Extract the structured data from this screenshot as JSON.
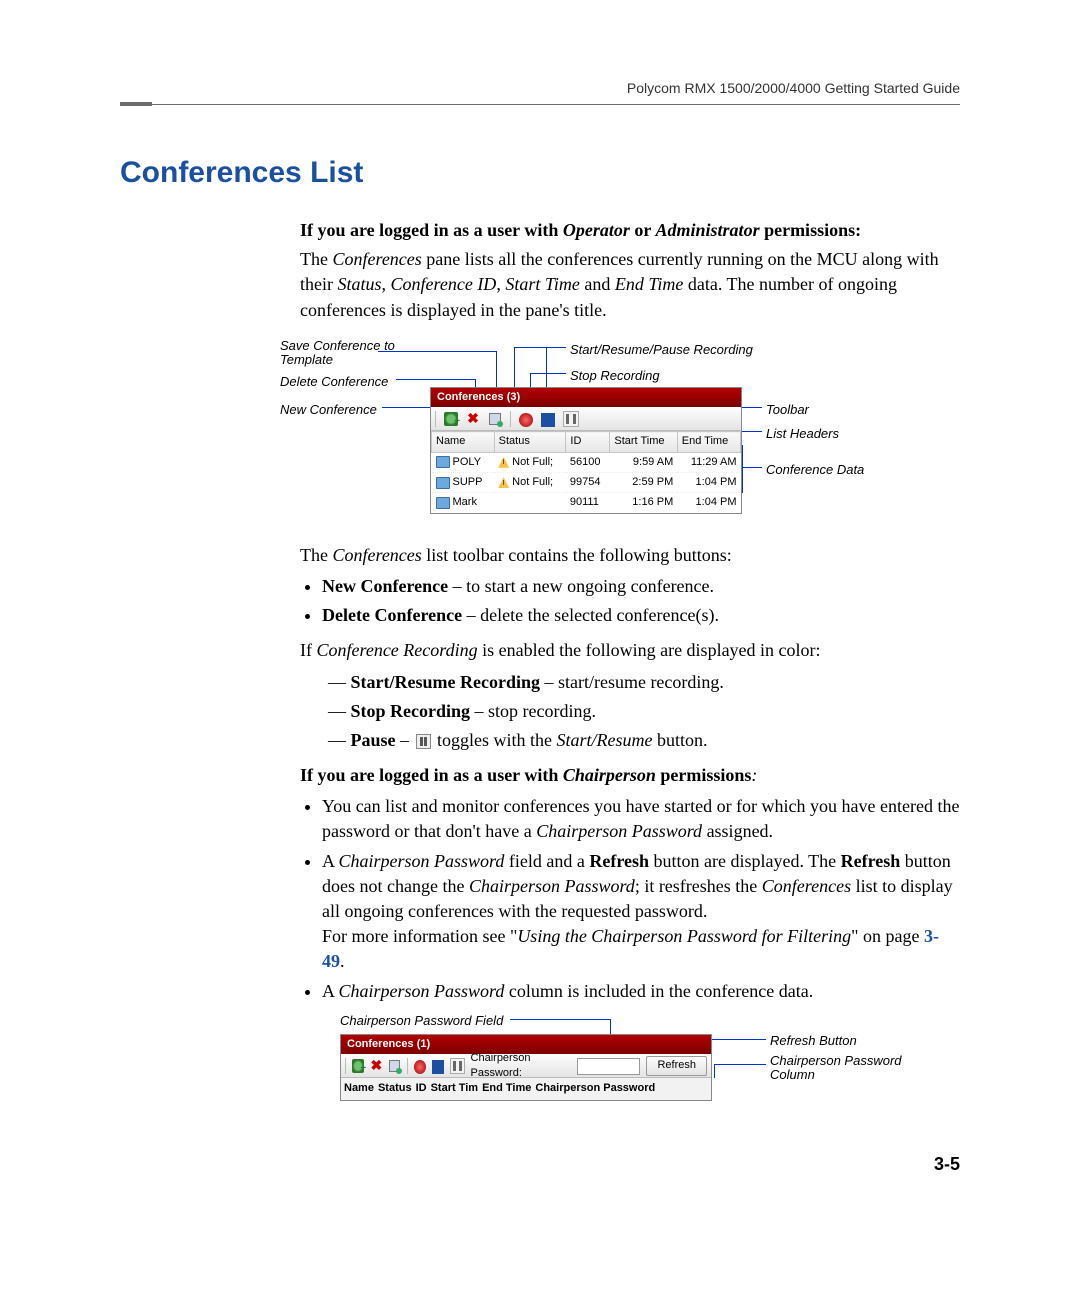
{
  "running_header": "Polycom RMX 1500/2000/4000 Getting Started Guide",
  "section_title": "Conferences List",
  "intro_bold_prefix": "If you are logged in as a user with ",
  "intro_bold_suffix": " permissions:",
  "intro_roles": "Operator",
  "intro_roles_or": " or ",
  "intro_roles2": "Administrator",
  "para1_a": "The ",
  "para1_b": "Conferences",
  "para1_c": " pane lists all the conferences currently running on the MCU along with their ",
  "para1_d": "Status",
  "para1_e": ", ",
  "para1_f": "Conference ID",
  "para1_g": ", ",
  "para1_h": "Start Time",
  "para1_i": " and ",
  "para1_j": "End Time",
  "para1_k": " data. The number of ongoing conferences is displayed in the pane's title.",
  "fig1": {
    "callouts": {
      "save": "Save Conference\nto Template",
      "delete": "Delete Conference",
      "new": "New Conference",
      "start": "Start/Resume/Pause Recording",
      "stop": "Stop Recording",
      "toolbar": "Toolbar",
      "headers": "List Headers",
      "data": "Conference Data"
    },
    "pane_title": "Conferences (3)",
    "columns": [
      "Name",
      "Status",
      "ID",
      "Start Time",
      "End Time"
    ],
    "rows": [
      {
        "name": "POLY",
        "status": "Not Full;",
        "id": "56100",
        "start": "9:59 AM",
        "end": "11:29 AM"
      },
      {
        "name": "SUPP",
        "status": "Not Full;",
        "id": "99754",
        "start": "2:59 PM",
        "end": "1:04 PM"
      },
      {
        "name": "Mark",
        "status": "",
        "id": "90111",
        "start": "1:16 PM",
        "end": "1:04 PM"
      }
    ]
  },
  "para2_a": "The ",
  "para2_b": "Conferences",
  "para2_c": " list toolbar contains the following buttons:",
  "bullet_new_b": "New Conference",
  "bullet_new_t": " – to start a new ongoing conference.",
  "bullet_del_b": "Delete Conference",
  "bullet_del_t": " – delete the selected conference(s).",
  "cond_rec_a": "If ",
  "cond_rec_b": "Conference Recording",
  "cond_rec_c": " is enabled the following are displayed in color:",
  "dash_start_b": "Start/Resume Recording",
  "dash_start_t": " – start/resume recording.",
  "dash_stop_b": "Stop Recording",
  "dash_stop_t": " – stop recording.",
  "dash_pause_b": "Pause",
  "dash_pause_t1": " – ",
  "dash_pause_t2": " toggles with the ",
  "dash_pause_t3": "Start/Resume",
  "dash_pause_t4": " button.",
  "chair_heading_a": "If you are logged in as a user with ",
  "chair_heading_b": "Chairperson",
  "chair_heading_c": " permissions",
  "chair_heading_d": ":",
  "chair_b1_a": "You can list and monitor conferences you have started or for which you have entered the password or that don't have a ",
  "chair_b1_b": "Chairperson Password",
  "chair_b1_c": " assigned.",
  "chair_b2_a": "A ",
  "chair_b2_b": "Chairperson Password",
  "chair_b2_c": " field and a ",
  "chair_b2_d": "Refresh",
  "chair_b2_e": " button are displayed. The ",
  "chair_b2_f": "Refresh",
  "chair_b2_g": " button does not change the ",
  "chair_b2_h": "Chairperson Password",
  "chair_b2_i": "; it resfreshes the ",
  "chair_b2_j": "Conferences",
  "chair_b2_k": " list to display all ongoing conferences with the requested password.",
  "chair_b2_more_a": "For more information see \"",
  "chair_b2_more_b": "Using the Chairperson Password for Filtering",
  "chair_b2_more_c": "\" on page ",
  "chair_b2_more_link": "3-49",
  "chair_b2_more_d": ".",
  "chair_b3_a": "A ",
  "chair_b3_b": "Chairperson Password",
  "chair_b3_c": " column is included in the conference data.",
  "fig2": {
    "callouts": {
      "field": "Chairperson Password Field",
      "refresh": "Refresh Button",
      "column": "Chairperson Password Column"
    },
    "pane_title": "Conferences (1)",
    "cp_label": "Chairperson Password:",
    "refresh_btn": "Refresh",
    "columns": [
      "Name",
      "Status",
      "ID",
      "Start Tim",
      "End Time",
      "Chairperson Password"
    ]
  },
  "pagenum": "3-5"
}
